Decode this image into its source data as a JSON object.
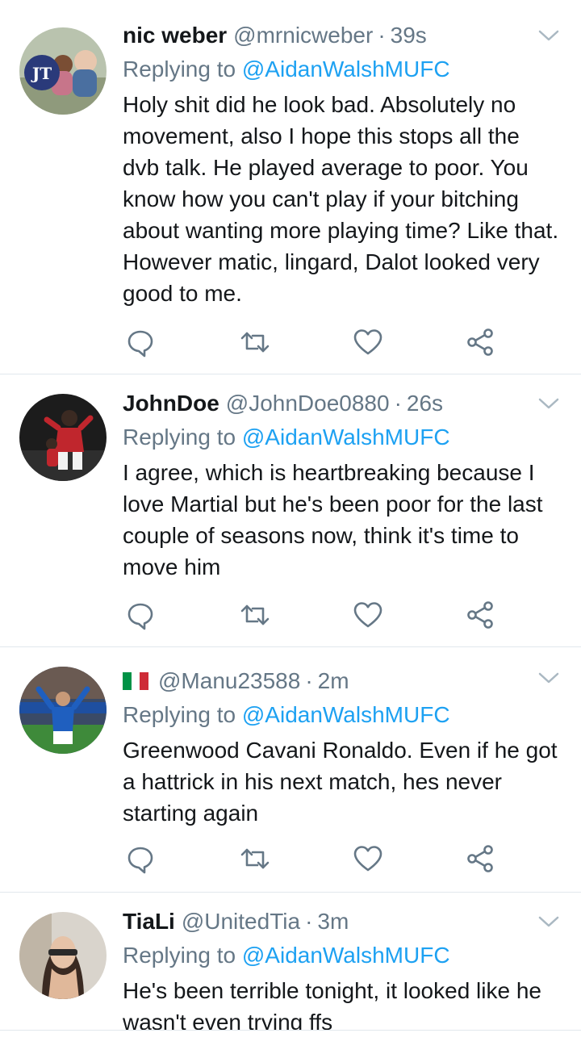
{
  "colors": {
    "accent": "#1da1f2",
    "secondary_text": "#657786",
    "divider": "#e1e8ed"
  },
  "tweets": [
    {
      "name": "nic weber",
      "handle": "@mrnicweber",
      "time": "39s",
      "replying_prefix": "Replying to",
      "replying_to": "@AidanWalshMUFC",
      "text": "Holy shit did he look bad. Absolutely no movement, also I hope this stops all the dvb talk. He played average to poor. You know how you can't play if your bitching about wanting more playing time? Like that. However matic, lingard, Dalot looked very good to me.",
      "avatar_icon": "avatar-photo-icon"
    },
    {
      "name": "JohnDoe",
      "handle": "@JohnDoe0880",
      "time": "26s",
      "replying_prefix": "Replying to",
      "replying_to": "@AidanWalshMUFC",
      "text": "I agree, which is heartbreaking because I love Martial but he's been poor for the last couple of seasons now, think it's time to move him",
      "avatar_icon": "avatar-photo-icon"
    },
    {
      "name": "",
      "flag_icon": "italy-flag-icon",
      "handle": "@Manu23588",
      "time": "2m",
      "replying_prefix": "Replying to",
      "replying_to": "@AidanWalshMUFC",
      "text": "Greenwood Cavani Ronaldo. Even if he got a hattrick in his next match, hes never starting again",
      "avatar_icon": "avatar-photo-icon"
    },
    {
      "name": "TiaLi",
      "handle": "@UnitedTia",
      "time": "3m",
      "replying_prefix": "Replying to",
      "replying_to": "@AidanWalshMUFC",
      "text": "He's been terrible tonight, it looked like he wasn't even trying ffs",
      "avatar_icon": "avatar-photo-icon"
    }
  ],
  "actions": [
    "reply-icon",
    "retweet-icon",
    "like-icon",
    "share-icon"
  ],
  "separator": "·"
}
